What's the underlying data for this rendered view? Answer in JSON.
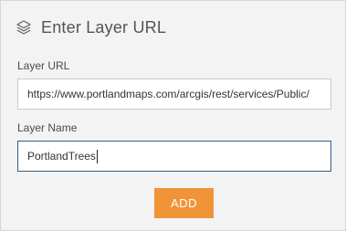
{
  "header": {
    "title": "Enter Layer URL",
    "icon": "layers-icon"
  },
  "form": {
    "url_label": "Layer URL",
    "url_value": "https://www.portlandmaps.com/arcgis/rest/services/Public/",
    "name_label": "Layer Name",
    "name_value": "PortlandTrees",
    "add_label": "ADD"
  },
  "colors": {
    "accent": "#f09437",
    "focus_border": "#2f5f8a",
    "panel_bg": "#f3f3f3"
  }
}
